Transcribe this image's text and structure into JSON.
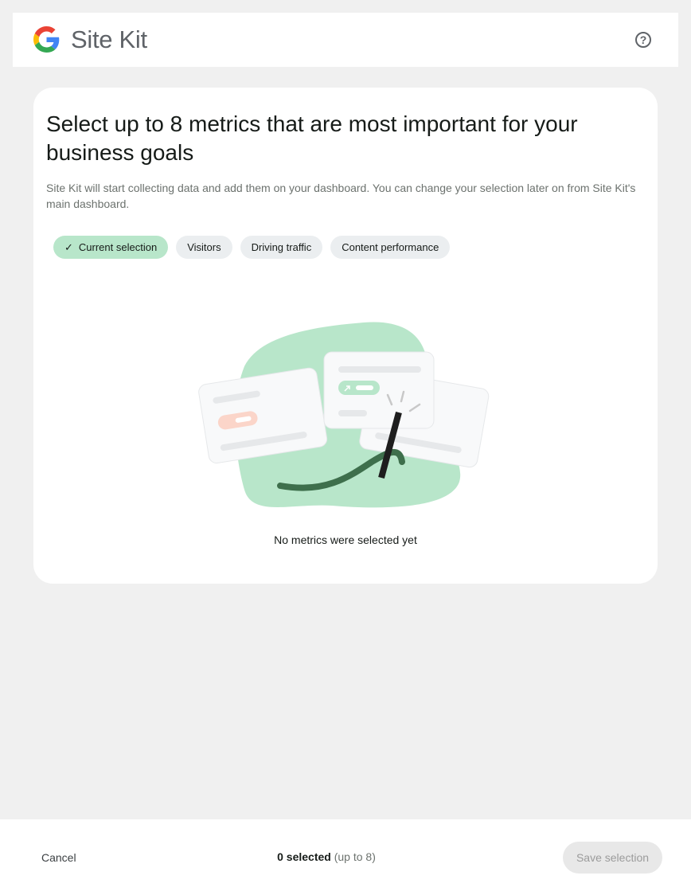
{
  "header": {
    "logo_text": "Site Kit",
    "help_icon_glyph": "?"
  },
  "main": {
    "title": "Select up to 8 metrics that are most important for your business goals",
    "description": "Site Kit will start collecting data and add them on your dashboard. You can change your selection later on from Site Kit's main dashboard.",
    "chips": [
      {
        "label": "Current selection",
        "active": true,
        "icon": "check-icon"
      },
      {
        "label": "Visitors",
        "active": false
      },
      {
        "label": "Driving traffic",
        "active": false
      },
      {
        "label": "Content performance",
        "active": false
      }
    ],
    "empty_state": "No metrics were selected yet"
  },
  "footer": {
    "cancel_label": "Cancel",
    "selected_count": "0 selected",
    "selected_limit": "(up to 8)",
    "save_label": "Save selection"
  },
  "colors": {
    "accent_green": "#b8e6ca",
    "chip_bg": "#ebeef0",
    "page_bg": "#f0f0f0"
  }
}
